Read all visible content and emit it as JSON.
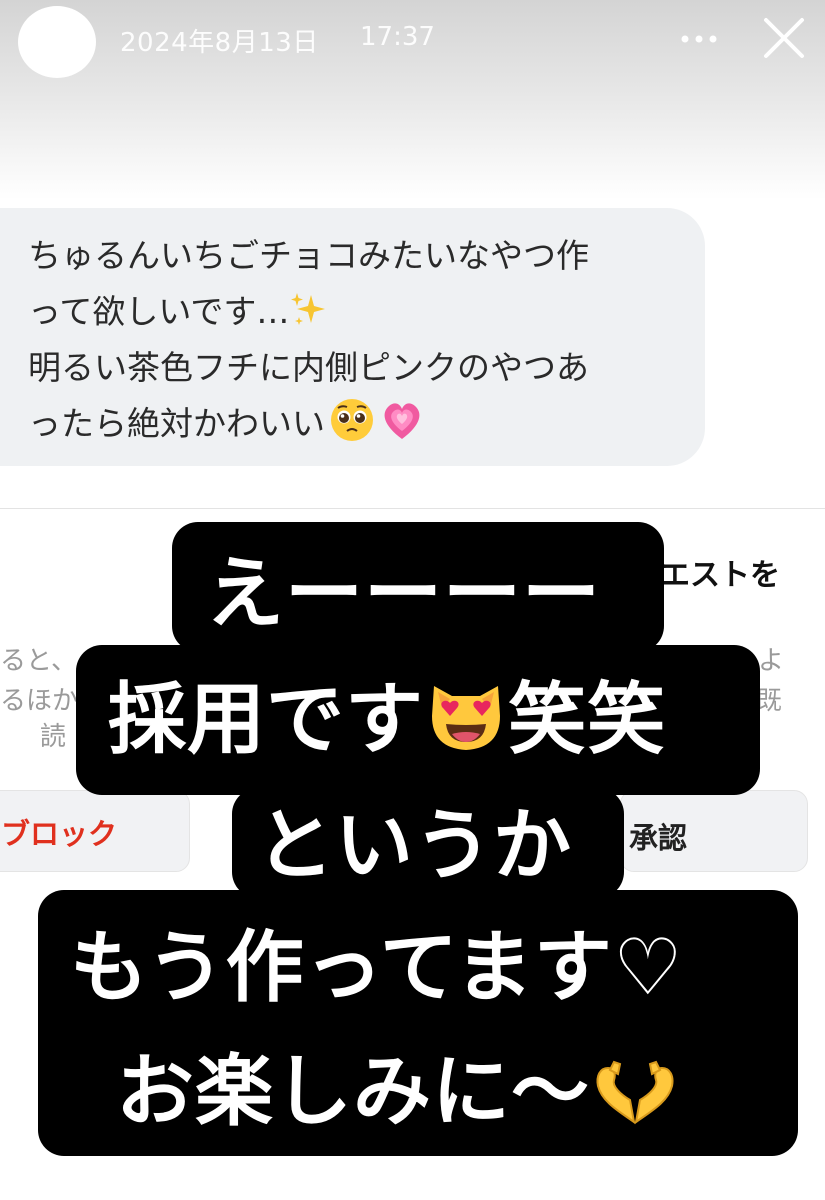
{
  "story_header": {
    "date": "2024年8月13日",
    "time": "17:37",
    "more_icon": "ellipsis-icon",
    "close_icon": "close-icon"
  },
  "message": {
    "lines": [
      "ちゅるんいちごチョコみたいなやつ作",
      "って欲しいです…",
      "明るい茶色フチに内側ピンクのやつあ",
      "ったら絶対かわいい"
    ],
    "emojis": [
      "sparkles-icon",
      "pleading-face-icon",
      "growing-heart-icon"
    ]
  },
  "request_panel": {
    "heading": "エストを",
    "description_line_1": "ると、",
    "description_line_2": "るほか",
    "description_line_3": "読",
    "side_line_1": "よ",
    "side_line_2": "既",
    "block_label": "ブロック",
    "accept_label": "承認"
  },
  "caption": {
    "line_1": "えーーーー",
    "line_2a": "採用です",
    "line_2b": "笑笑",
    "line_3": "というか",
    "line_4": "もう作ってます♡",
    "line_5": "お楽しみに〜",
    "emojis": [
      "heart-eyes-cat-icon",
      "heart-hands-icon"
    ]
  },
  "colors": {
    "bubble_bg": "#eff1f3",
    "block_red": "#e0301e",
    "caption_bg": "#000000",
    "caption_text": "#ffffff"
  }
}
